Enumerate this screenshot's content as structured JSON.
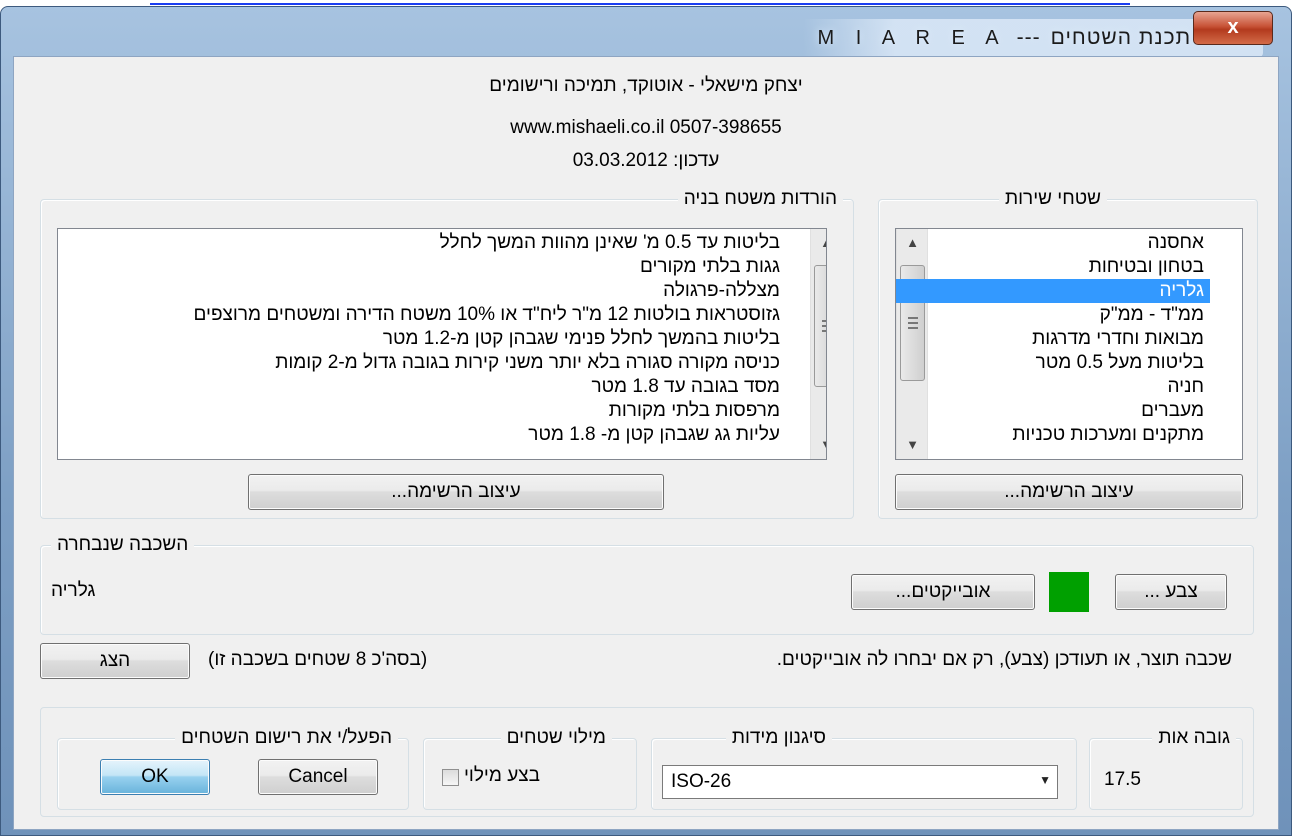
{
  "window": {
    "title_app": "M I A R E A",
    "title_sep": "---",
    "title_main": "מנהל תכנת השטחים",
    "close_label": "x"
  },
  "header": {
    "author_line": "יצחק מישאלי - אוטוקד, תמיכה ורישומים",
    "contact_line": "www.mishaeli.co.il  0507-398655",
    "update_line": "עדכון: 03.03.2012"
  },
  "reductions_group": {
    "legend": "הורדות משטח בניה",
    "items": [
      "בליטות עד 0.5 מ' שאינן מהוות המשך לחלל",
      "גגות בלתי מקורים",
      "מצללה-פרגולה",
      "גזוסטראות בולטות 12 מ\"ר ליח\"ד או 10% משטח הדירה ומשטחים מרוצפים",
      "בליטות בהמשך לחלל פנימי שגבהן קטן מ-1.2 מטר",
      "כניסה מקורה סגורה בלא יותר משני קירות בגובה גדול מ-2 קומות",
      "מסד בגובה עד 1.8 מטר",
      "מרפסות בלתי מקורות",
      "עליות גג שגבהן קטן מ- 1.8 מטר"
    ],
    "edit_button": "עיצוב הרשימה..."
  },
  "service_group": {
    "legend": "שטחי שירות",
    "items": [
      "אחסנה",
      "בטחון ובטיחות",
      "גלריה",
      "ממ\"ד - ממ\"ק",
      "מבואות וחדרי מדרגות",
      "בליטות מעל 0.5 מטר",
      "חניה",
      "מעברים",
      "מתקנים ומערכות טכניות"
    ],
    "selected_index": 2,
    "edit_button": "עיצוב הרשימה..."
  },
  "selected_layer": {
    "legend": "השכבה שנבחרה",
    "name": "גלריה",
    "objects_button": "אובייקטים...",
    "color_button": "צבע ...",
    "swatch_color": "#00a000"
  },
  "notice": {
    "text": "שכבה תוצר, או תעודכן (צבע), רק אם יבחרו לה אובייקטים.",
    "count_text": "(בסה'כ 8 שטחים בשכבה זו)",
    "show_button": "הצג"
  },
  "bottom": {
    "activate_legend": "הפעל/י את רישום השטחים",
    "ok_button": "OK",
    "cancel_button": "Cancel",
    "fill_legend": "מילוי שטחים",
    "fill_checkbox_label": "בצע מילוי",
    "fill_checked": false,
    "dim_legend": "סיגנון מידות",
    "dim_value": "ISO-26",
    "height_legend": "גובה אות",
    "height_value": "17.5"
  }
}
